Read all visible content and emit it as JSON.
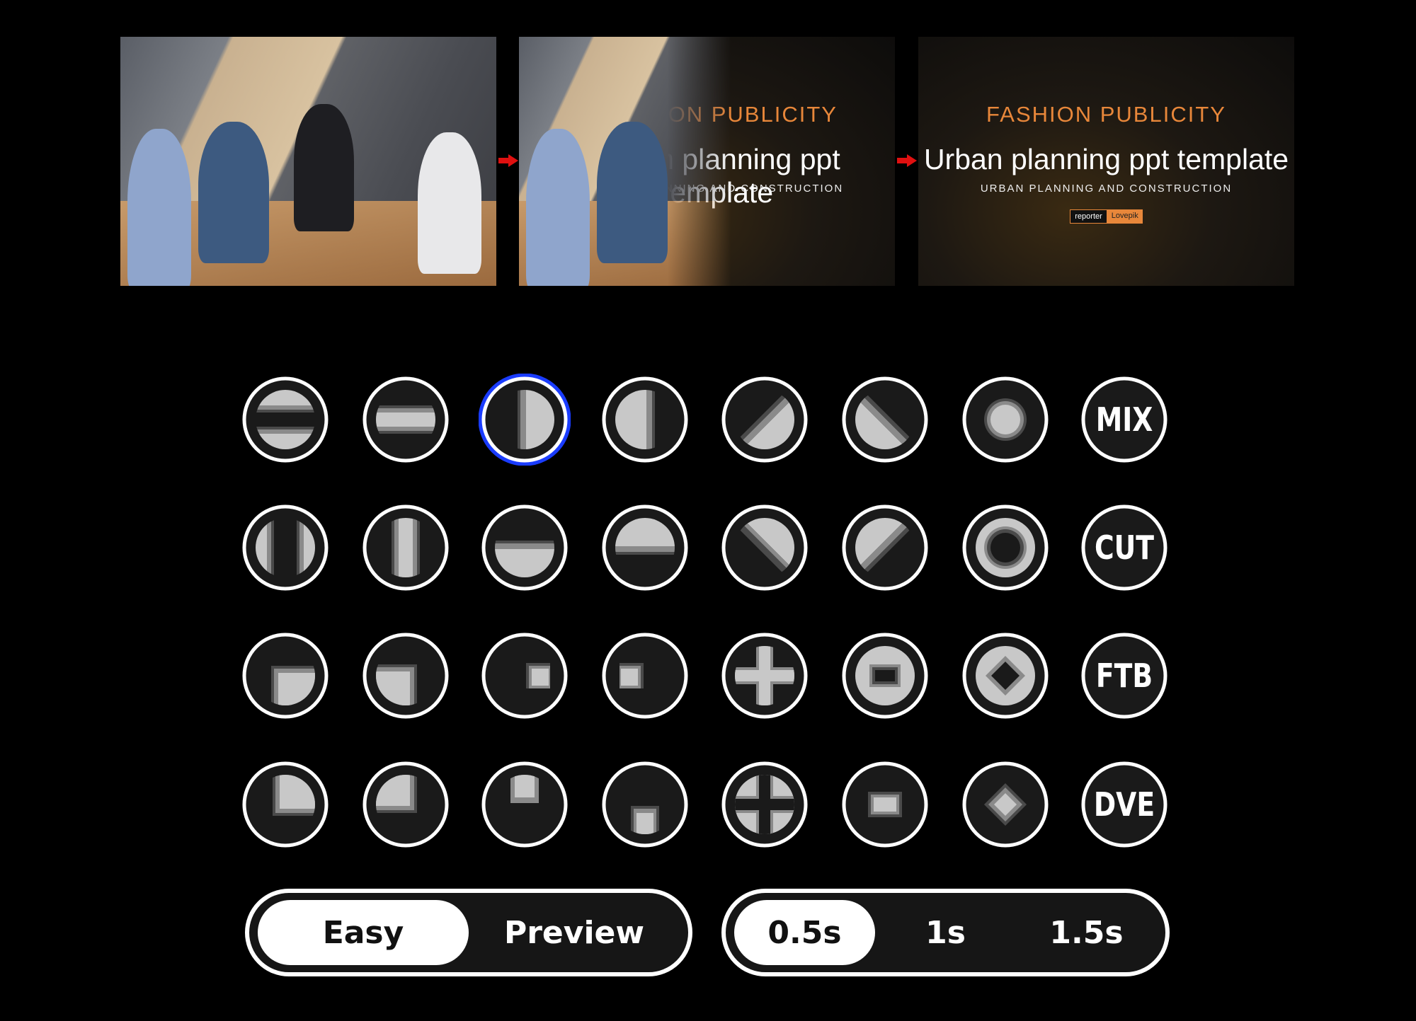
{
  "preview": {
    "slide": {
      "kicker": "FASHION PUBLICITY",
      "title": "Urban planning ppt template",
      "subtitle": "URBAN PLANNING AND CONSTRUCTION",
      "tag_left": "reporter",
      "tag_right": "Lovepik"
    },
    "accent": "#e8873a",
    "arrow_color": "#e01010"
  },
  "transitions": {
    "selected": "2",
    "selection_color": "#1a3cff",
    "rows": [
      [
        {
          "icon": "wipe-horizontal-in-icon"
        },
        {
          "icon": "wipe-horizontal-out-icon"
        },
        {
          "icon": "wipe-right-icon"
        },
        {
          "icon": "wipe-left-icon"
        },
        {
          "icon": "wipe-diagonal-up-icon"
        },
        {
          "icon": "wipe-diagonal-down-icon"
        },
        {
          "icon": "iris-circle-out-icon"
        },
        {
          "icon": "mix-icon",
          "label": "MIX"
        }
      ],
      [
        {
          "icon": "wipe-vertical-in-icon"
        },
        {
          "icon": "wipe-vertical-out-icon"
        },
        {
          "icon": "wipe-down-icon"
        },
        {
          "icon": "wipe-up-icon"
        },
        {
          "icon": "wipe-diagonal-down-2-icon"
        },
        {
          "icon": "wipe-diagonal-up-2-icon"
        },
        {
          "icon": "iris-circle-in-icon"
        },
        {
          "icon": "cut-icon",
          "label": "CUT"
        }
      ],
      [
        {
          "icon": "box-corner-br-icon"
        },
        {
          "icon": "box-corner-bl-icon"
        },
        {
          "icon": "box-right-icon"
        },
        {
          "icon": "box-left-icon"
        },
        {
          "icon": "cross-out-icon"
        },
        {
          "icon": "box-center-in-icon"
        },
        {
          "icon": "diamond-in-icon"
        },
        {
          "icon": "ftb-icon",
          "label": "FTB"
        }
      ],
      [
        {
          "icon": "box-corner-tr-icon"
        },
        {
          "icon": "box-corner-tl-icon"
        },
        {
          "icon": "box-top-icon"
        },
        {
          "icon": "box-bottom-icon"
        },
        {
          "icon": "cross-in-icon"
        },
        {
          "icon": "box-center-out-icon"
        },
        {
          "icon": "diamond-out-icon"
        },
        {
          "icon": "dve-icon",
          "label": "DVE"
        }
      ]
    ]
  },
  "mode_toggle": {
    "options": [
      "Easy",
      "Preview"
    ],
    "selected": "Easy"
  },
  "duration_toggle": {
    "options": [
      "0.5s",
      "1s",
      "1.5s"
    ],
    "selected": "0.5s"
  }
}
